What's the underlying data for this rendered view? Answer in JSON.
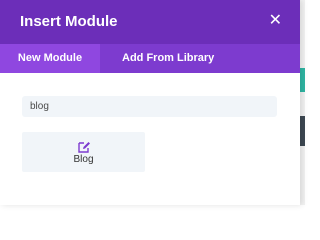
{
  "modal": {
    "title": "Insert Module",
    "close_icon": "close-icon",
    "tabs": [
      {
        "label": "New Module",
        "active": true
      },
      {
        "label": "Add From Library",
        "active": false
      }
    ],
    "search": {
      "value": "blog",
      "placeholder": ""
    },
    "modules": [
      {
        "label": "Blog",
        "icon": "blog-edit-icon"
      }
    ]
  },
  "colors": {
    "header": "#6c2eb9",
    "tab_bar": "#7d3bcf",
    "active_tab": "#8f47e0",
    "card_bg": "#f1f5f9",
    "icon_accent": "#7d3bcf"
  }
}
